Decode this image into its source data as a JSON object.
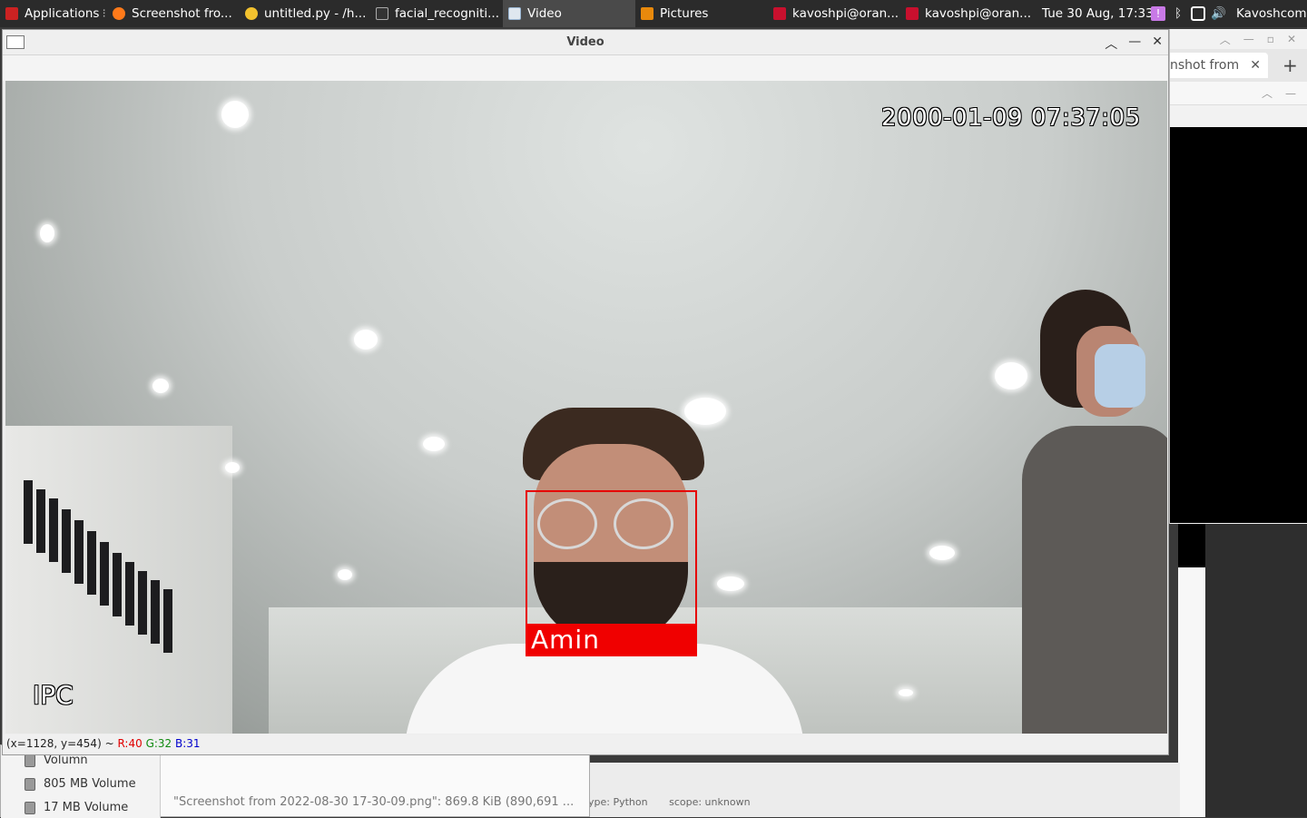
{
  "panel": {
    "tasks": [
      {
        "label": "Applications",
        "icon": "app-menu-icon",
        "color": "#cc2222"
      },
      {
        "label": "Screenshot fro...",
        "icon": "firefox-icon",
        "color": "#ff7a1a"
      },
      {
        "label": "untitled.py - /h...",
        "icon": "python-editor-icon",
        "color": "#f2c12e"
      },
      {
        "label": "facial_recogniti...",
        "icon": "terminal-icon",
        "color": "#555555"
      },
      {
        "label": "Video",
        "icon": "window-icon",
        "color": "#9bb7d4"
      },
      {
        "label": "Pictures",
        "icon": "folder-image-icon",
        "color": "#e8890c"
      },
      {
        "label": "kavoshpi@oran...",
        "icon": "terminal-red-icon",
        "color": "#c8102e"
      },
      {
        "label": "kavoshpi@oran...",
        "icon": "terminal-red-icon",
        "color": "#c8102e"
      }
    ],
    "clock": "Tue 30 Aug, 17:33",
    "user": "Kavoshcom",
    "tray_icons": [
      "alert-icon",
      "bluetooth-icon",
      "network-icon",
      "volume-icon"
    ]
  },
  "browser_window": {
    "tab_label": "nshot from",
    "new_tab": "+"
  },
  "file_manager": {
    "volumes": [
      "Volumn",
      "805 MB Volume",
      "17 MB Volume"
    ],
    "status": "\"Screenshot from 2022-08-30 17-30-09.png\": 869.8 KiB (890,691 ..."
  },
  "editor": {
    "status_type": "ype: Python",
    "status_scope": "scope: unknown"
  },
  "video_window": {
    "title": "Video",
    "osd_timestamp": "2000-01-09 07:37:05",
    "osd_camera": "IPC",
    "face_label": "Amin",
    "status": {
      "coords": "(x=1128, y=454) ~",
      "r": "R:40",
      "g": "G:32",
      "b": "B:31"
    }
  }
}
